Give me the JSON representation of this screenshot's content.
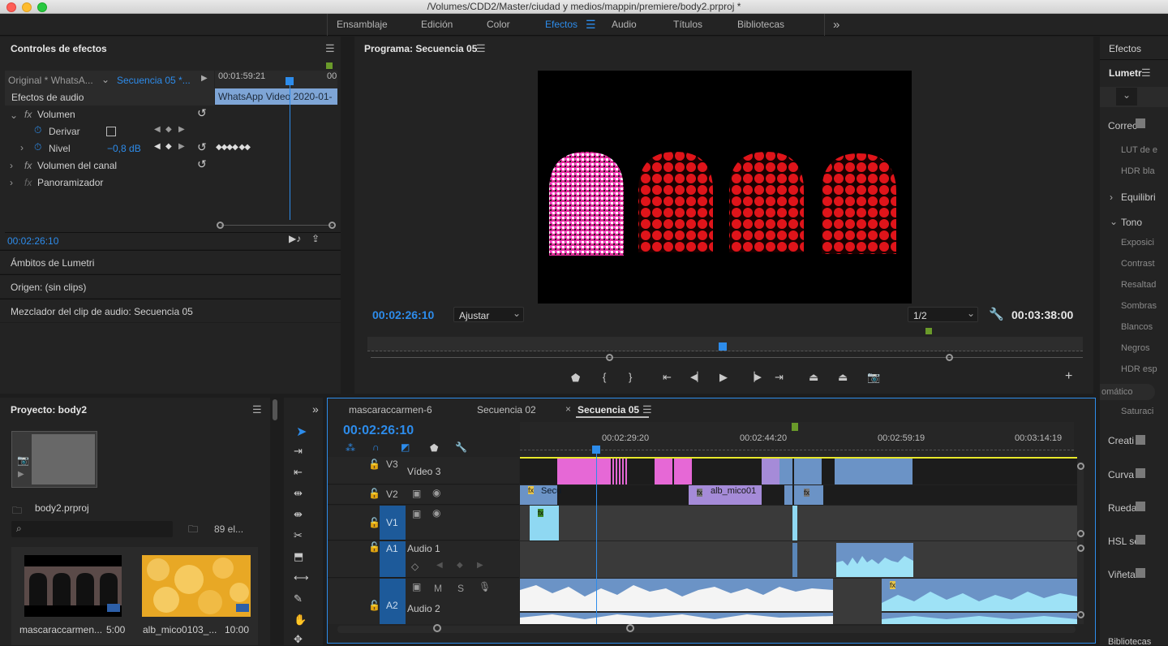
{
  "window": {
    "title": "/Volumes/CDD2/Master/ciudad y medios/mappin/premiere/body2.prproj *"
  },
  "workspaces": [
    "Ensamblaje",
    "Edición",
    "Color",
    "Efectos",
    "Audio",
    "Títulos",
    "Bibliotecas"
  ],
  "workspace_active": "Efectos",
  "effect_controls": {
    "title": "Controles de efectos",
    "source_tab": "Original * WhatsA...",
    "sequence_tab": "Secuencia 05 *...",
    "timecode_start": "00:01:59:21",
    "timecode_end": "00",
    "clip_name": "WhatsApp Video 2020-01-",
    "section": "Efectos de audio",
    "rows": [
      {
        "label": "Volumen",
        "fx": "fx"
      },
      {
        "label": "Derivar"
      },
      {
        "label": "Nivel",
        "value": "−0,8 dB"
      },
      {
        "label": "Volumen del canal",
        "fx": "fx"
      },
      {
        "label": "Panoramizador",
        "fx": "fx"
      }
    ],
    "current_time": "00:02:26:10"
  },
  "stacked_panels": [
    "Ámbitos de Lumetri",
    "Origen: (sin clips)",
    "Mezclador del clip de audio: Secuencia 05"
  ],
  "program": {
    "title": "Programa: Secuencia 05",
    "timecode": "00:02:26:10",
    "fit": "Ajustar",
    "resolution": "1/2",
    "duration": "00:03:38:00"
  },
  "effects_panel": {
    "title": "Efectos",
    "lumetri": "Lumetr",
    "items": [
      "Correc",
      "LUT de e",
      "HDR bla",
      "Equilibri",
      "Tono",
      "Exposici",
      "Contrast",
      "Resaltad",
      "Sombras",
      "Blancos",
      "Negros",
      "HDR esp",
      "omático",
      "Saturaci",
      "Creati",
      "Curva",
      "Rueda",
      "HSL se",
      "Viñeta",
      "Bibliotecas"
    ]
  },
  "project": {
    "title": "Proyecto: body2",
    "file": "body2.prproj",
    "count": "89 el...",
    "search_placeholder": "",
    "items": [
      {
        "name": "mascaraccarmen...",
        "duration": "5:00"
      },
      {
        "name": "alb_mico0103_...",
        "duration": "10:00"
      }
    ]
  },
  "timeline": {
    "tabs": [
      "mascaraccarmen-6",
      "Secuencia 02",
      "Secuencia 05"
    ],
    "active_tab": "Secuencia 05",
    "timecode": "00:02:26:10",
    "ruler": [
      "00:02:29:20",
      "00:02:44:20",
      "00:02:59:19",
      "00:03:14:19"
    ],
    "tracks": [
      {
        "id": "V3",
        "name": "Vídeo 3"
      },
      {
        "id": "V2",
        "name": ""
      },
      {
        "id": "V1",
        "name": ""
      },
      {
        "id": "A1",
        "name": "Audio 1"
      },
      {
        "id": "A2",
        "name": "Audio 2"
      }
    ],
    "clip_labels": {
      "v2a": "Secu",
      "v2b": "alb_mico01"
    },
    "audio_buttons": {
      "m": "M",
      "s": "S"
    }
  },
  "colors": {
    "accent": "#2d8ceb",
    "pink": "#e668d6",
    "purple": "#a58bd8",
    "clip_blue": "#6b93c6",
    "cyan": "#8fd8f2",
    "green": "#6a9a2a"
  }
}
